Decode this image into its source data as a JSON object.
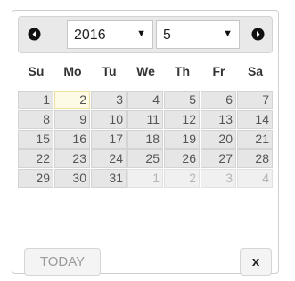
{
  "header": {
    "prev_icon": "chevron-left-circle-icon",
    "next_icon": "chevron-right-circle-icon",
    "year_select": {
      "value": "2016",
      "arrow": "▼"
    },
    "month_select": {
      "value": "5",
      "arrow": "▼"
    }
  },
  "weekdays": [
    "Su",
    "Mo",
    "Tu",
    "We",
    "Th",
    "Fr",
    "Sa"
  ],
  "calendar": {
    "weeks": [
      [
        "1",
        "2",
        "3",
        "4",
        "5",
        "6",
        "7"
      ],
      [
        "8",
        "9",
        "10",
        "11",
        "12",
        "13",
        "14"
      ],
      [
        "15",
        "16",
        "17",
        "18",
        "19",
        "20",
        "21"
      ],
      [
        "22",
        "23",
        "24",
        "25",
        "26",
        "27",
        "28"
      ],
      [
        "29",
        "30",
        "31",
        "1",
        "2",
        "3",
        "4"
      ]
    ],
    "highlighted_day": "2"
  },
  "footer": {
    "today_label": "TODAY",
    "close_label": "x"
  },
  "colors": {
    "header_bg": "#e9e9e9",
    "cell_bg": "#e6e6e6",
    "today_bg": "#fdfbe6"
  }
}
